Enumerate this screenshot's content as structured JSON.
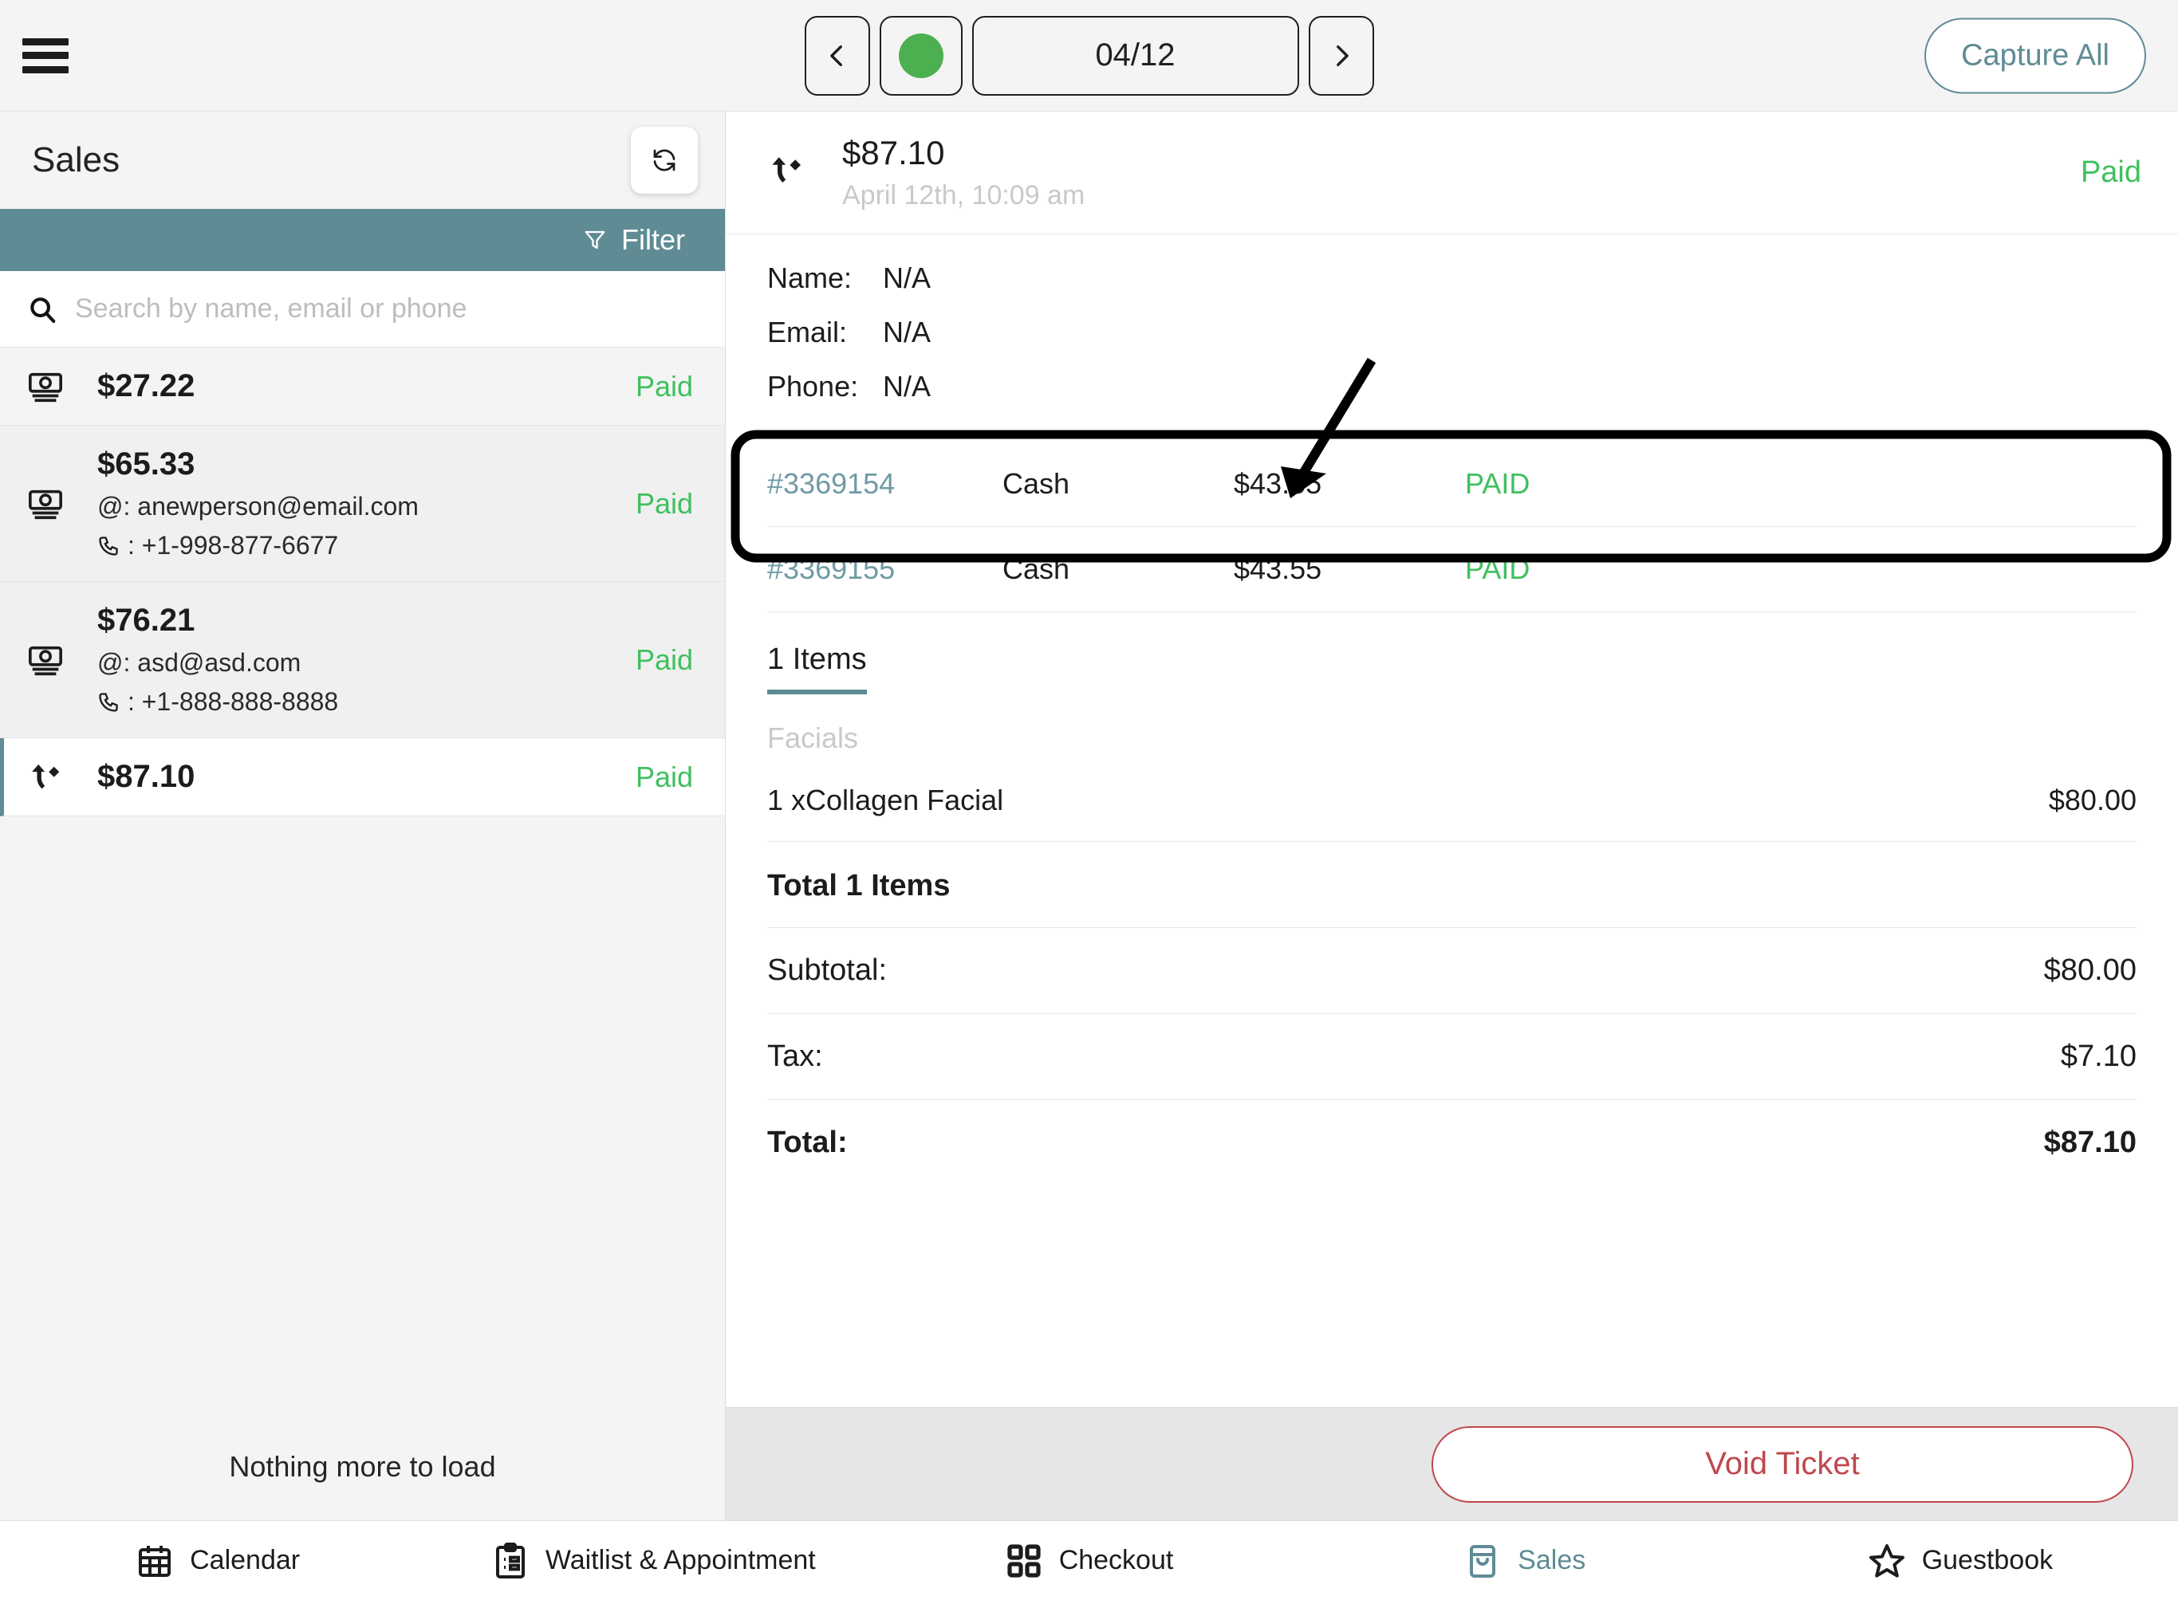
{
  "topbar": {
    "menu_icon": "hamburger-icon",
    "prev_icon": "chevron-left-icon",
    "status_dot_color": "#4caf50",
    "date_value": "04/12",
    "next_icon": "chevron-right-icon",
    "capture_all_label": "Capture All",
    "accent_color": "#5f8b95"
  },
  "sidebar": {
    "title": "Sales",
    "refresh_icon": "refresh-icon",
    "filter_label": "Filter",
    "filter_icon": "filter-icon",
    "search": {
      "icon": "search-icon",
      "value": "",
      "placeholder": "Search by name, email or phone"
    },
    "items": [
      {
        "icon": "cash-icon",
        "amount": "$27.22",
        "email": "",
        "phone": "",
        "status": "Paid",
        "selected": false
      },
      {
        "icon": "cash-icon",
        "amount": "$65.33",
        "email": "@: anewperson@email.com",
        "phone": ": +1-998-877-6677",
        "status": "Paid",
        "selected": false
      },
      {
        "icon": "cash-icon",
        "amount": "$76.21",
        "email": "@: asd@asd.com",
        "phone": ": +1-888-888-8888",
        "status": "Paid",
        "selected": false
      },
      {
        "icon": "split-payment-icon",
        "amount": "$87.10",
        "email": "",
        "phone": "",
        "status": "Paid",
        "selected": true
      }
    ],
    "footer_text": "Nothing more to load"
  },
  "detail": {
    "header": {
      "icon": "split-payment-icon",
      "amount": "$87.10",
      "datetime": "April 12th, 10:09 am",
      "status": "Paid"
    },
    "contact": [
      {
        "label": "Name:",
        "value": "N/A"
      },
      {
        "label": "Email:",
        "value": "N/A"
      },
      {
        "label": "Phone:",
        "value": "N/A"
      }
    ],
    "payments": [
      {
        "id": "#3369154",
        "method": "Cash",
        "amount": "$43.55",
        "state": "PAID",
        "highlighted": true
      },
      {
        "id": "#3369155",
        "method": "Cash",
        "amount": "$43.55",
        "state": "PAID",
        "highlighted": false
      }
    ],
    "items_tab_label": "1 Items",
    "category_label": "Facials",
    "line_items": [
      {
        "name": "1 xCollagen Facial",
        "price": "$80.00"
      }
    ],
    "total_items_label": "Total 1 Items",
    "summary": [
      {
        "label": "Subtotal:",
        "value": "$80.00"
      },
      {
        "label": "Tax:",
        "value": "$7.10"
      },
      {
        "label": "Total:",
        "value": "$87.10"
      }
    ],
    "void_button_label": "Void Ticket"
  },
  "bottomnav": {
    "items": [
      {
        "icon": "calendar-icon",
        "label": "Calendar",
        "active": false
      },
      {
        "icon": "clipboard-list-icon",
        "label": "Waitlist & Appointment",
        "active": false
      },
      {
        "icon": "grid-squares-icon",
        "label": "Checkout",
        "active": false
      },
      {
        "icon": "shopping-bag-icon",
        "label": "Sales",
        "active": true
      },
      {
        "icon": "star-icon",
        "label": "Guestbook",
        "active": false
      }
    ]
  }
}
